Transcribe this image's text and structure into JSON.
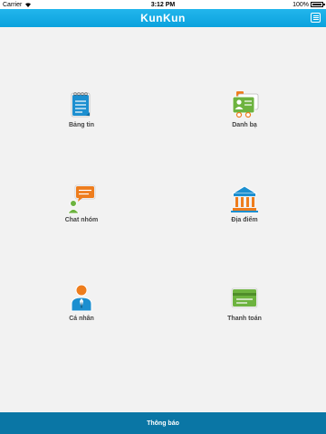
{
  "status_bar": {
    "carrier": "Carrier",
    "time": "3:12 PM",
    "battery": "100%"
  },
  "header": {
    "title": "KunKun",
    "menu_icon": "hamburger-menu-icon"
  },
  "tiles": [
    {
      "label": "Bảng tin",
      "icon": "notepad-icon"
    },
    {
      "label": "Danh bạ",
      "icon": "contacts-icon"
    },
    {
      "label": "Chat nhóm",
      "icon": "chat-bubble-icon"
    },
    {
      "label": "Địa điểm",
      "icon": "building-icon"
    },
    {
      "label": "Cá nhân",
      "icon": "person-icon"
    },
    {
      "label": "Thanh toán",
      "icon": "payment-card-icon"
    }
  ],
  "bottom_bar": {
    "label": "Thông báo"
  },
  "colors": {
    "header": "#0ba2dd",
    "bottom_bar": "#0a76a5",
    "blue_icon": "#1c8fd0",
    "orange_icon": "#ee7d1d",
    "green_icon": "#6db33f"
  }
}
